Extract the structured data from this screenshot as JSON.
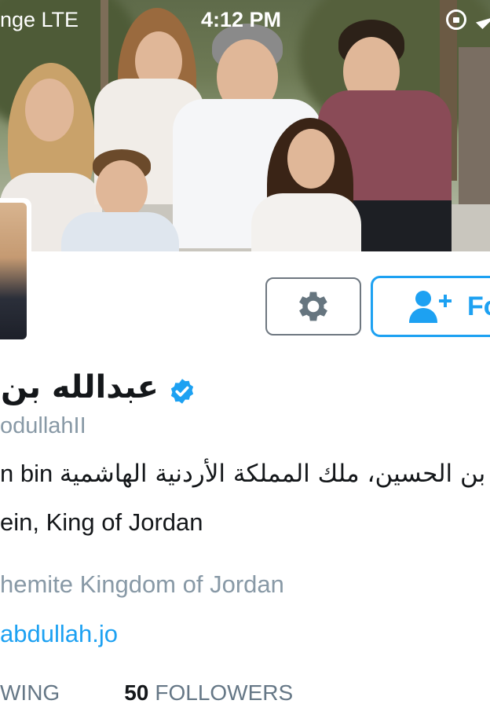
{
  "status_bar": {
    "carrier": "nge  LTE",
    "time": "4:12 PM",
    "icons": [
      "rotation-lock-icon",
      "location-arrow-icon"
    ]
  },
  "profile": {
    "display_name": "عبدالله بن ا",
    "verified": true,
    "handle": "odullahII",
    "bio_line1_arabic": "بن الحسين، ملك المملكة الأردنية الهاشمية",
    "bio_line1_latin": "n bin ",
    "bio_line2": "ein, King of Jordan",
    "location": "hemite Kingdom of Jordan",
    "website": "abdullah.jo"
  },
  "buttons": {
    "settings_icon": "gear-icon",
    "follow_icon": "add-user-icon",
    "follow_label": "Fo"
  },
  "stats": {
    "following_label": "WING",
    "followers_count": "50",
    "followers_label": "FOLLOWERS"
  },
  "colors": {
    "accent": "#1da1f2",
    "secondary_text": "#8899a6",
    "primary_text": "#14171a"
  }
}
